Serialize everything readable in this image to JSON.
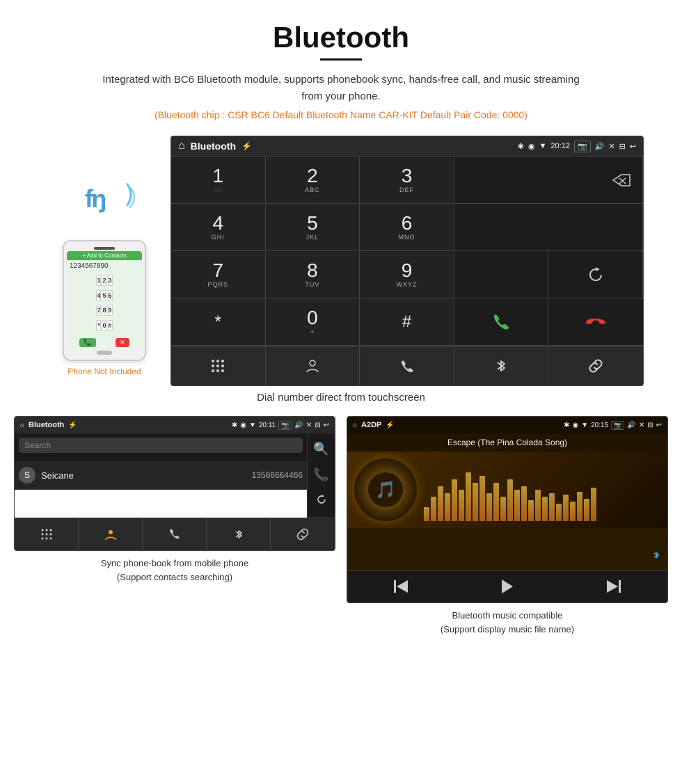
{
  "page": {
    "title": "Bluetooth",
    "description": "Integrated with BC6 Bluetooth module, supports phonebook sync, hands-free call, and music streaming from your phone.",
    "chip_info": "(Bluetooth chip : CSR BC6    Default Bluetooth Name CAR-KIT    Default Pair Code: 0000)",
    "main_caption": "Dial number direct from touchscreen",
    "phone_not_included": "Phone Not Included"
  },
  "dialer": {
    "status_bar": {
      "title": "Bluetooth",
      "time": "20:12"
    },
    "keys": [
      {
        "num": "1",
        "sub": "◌◌"
      },
      {
        "num": "2",
        "sub": "ABC"
      },
      {
        "num": "3",
        "sub": "DEF"
      },
      {
        "num": "",
        "sub": ""
      },
      {
        "num": "⌫",
        "sub": ""
      },
      {
        "num": "4",
        "sub": "GHI"
      },
      {
        "num": "5",
        "sub": "JKL"
      },
      {
        "num": "6",
        "sub": "MNO"
      },
      {
        "num": "",
        "sub": ""
      },
      {
        "num": "↺",
        "sub": ""
      },
      {
        "num": "7",
        "sub": "PQRS"
      },
      {
        "num": "8",
        "sub": "TUV"
      },
      {
        "num": "9",
        "sub": "WXYZ"
      },
      {
        "num": "📞",
        "sub": "green"
      },
      {
        "num": "📞",
        "sub": "red"
      },
      {
        "num": "*",
        "sub": ""
      },
      {
        "num": "0",
        "sub": "+"
      },
      {
        "num": "#",
        "sub": ""
      }
    ],
    "toolbar": [
      "⋮⋮⋮",
      "👤",
      "📞",
      "✱",
      "🔗"
    ]
  },
  "phonebook": {
    "status_bar": {
      "title": "Bluetooth",
      "time": "20:11"
    },
    "search_placeholder": "Search",
    "contacts": [
      {
        "letter": "S",
        "name": "Seicane",
        "number": "13566664466"
      }
    ],
    "right_icons": [
      "🔍",
      "📞",
      "↺"
    ],
    "toolbar": [
      "⋮⋮⋮",
      "👤",
      "📞",
      "✱",
      "🔗"
    ],
    "caption1": "Sync phone-book from mobile phone",
    "caption2": "(Support contacts searching)"
  },
  "music": {
    "status_bar": {
      "title": "A2DP",
      "time": "20:15"
    },
    "song_title": "Escape (The Pina Colada Song)",
    "eq_bars": [
      20,
      35,
      50,
      40,
      60,
      45,
      70,
      55,
      65,
      40,
      55,
      35,
      60,
      45,
      50,
      30,
      45,
      35,
      40,
      25,
      38,
      28,
      42,
      32,
      48
    ],
    "toolbar": [
      "⏮",
      "⏯",
      "⏭"
    ],
    "caption1": "Bluetooth music compatible",
    "caption2": "(Support display music file name)"
  },
  "icons": {
    "home": "⌂",
    "back": "↩",
    "bluetooth_symbol": "ʩ",
    "search": "🔍",
    "call_green": "📞",
    "call_red": "📵",
    "keypad": "⋮⋮⋮",
    "person": "👤",
    "phone": "📞",
    "bluetooth": "✱",
    "link": "🔗",
    "prev": "⏮",
    "play_pause": "⏯",
    "next": "⏭",
    "backspace": "⌫",
    "refresh": "↺"
  }
}
